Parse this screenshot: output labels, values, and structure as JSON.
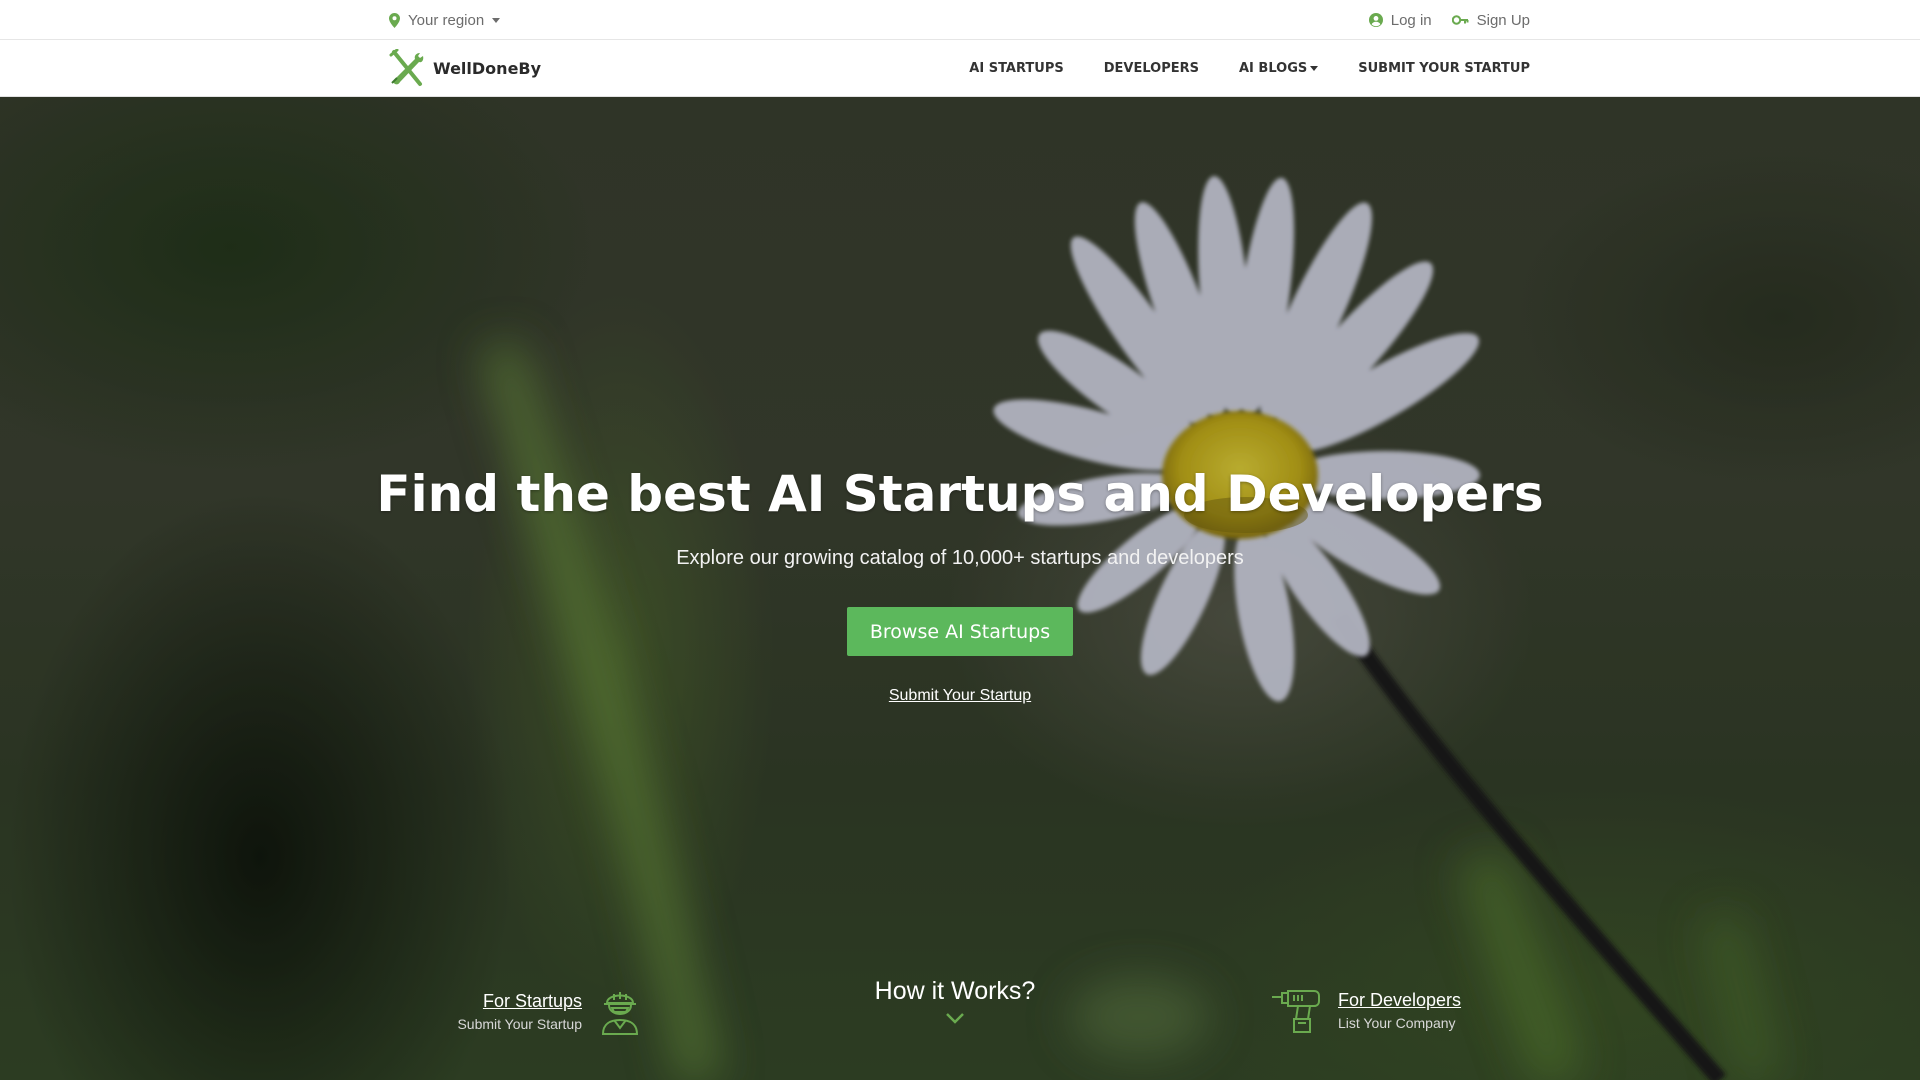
{
  "topbar": {
    "region_label": "Your region",
    "login_label": "Log in",
    "signup_label": "Sign Up"
  },
  "nav": {
    "brand_name": "WellDoneBy",
    "items": [
      {
        "label": "AI STARTUPS",
        "has_dropdown": false
      },
      {
        "label": "DEVELOPERS",
        "has_dropdown": false
      },
      {
        "label": "AI BLOGS",
        "has_dropdown": true
      },
      {
        "label": "SUBMIT YOUR STARTUP",
        "has_dropdown": false
      }
    ]
  },
  "hero": {
    "title": "Find the best AI Startups and Developers",
    "subtitle": "Explore our growing catalog of 10,000+ startups and developers",
    "cta_label": "Browse AI Startups",
    "submit_link": "Submit Your Startup",
    "how_label": "How it Works?",
    "for_startups": {
      "link": "For Startups",
      "sub": "Submit Your Startup"
    },
    "for_developers": {
      "link": "For Developers",
      "sub": "List Your Company"
    }
  },
  "icons": {
    "region": "map-pin-icon",
    "login": "user-circle-icon",
    "signup": "key-icon",
    "brand": "tools-logo-icon",
    "startups": "worker-helmet-icon",
    "developers": "drill-icon",
    "how": "chevron-down-icon"
  },
  "colors": {
    "accent": "#5cb85c",
    "icon_green": "#6aaa4f",
    "nav_text": "#333333",
    "topbar_text": "#6c6c6c"
  }
}
